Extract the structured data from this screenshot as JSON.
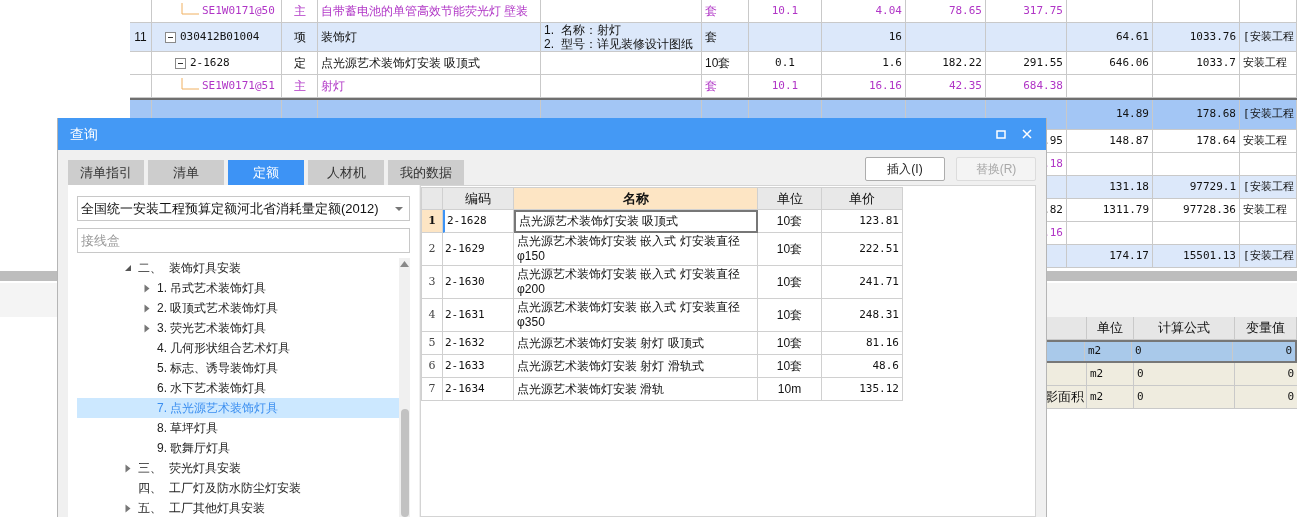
{
  "sheet": {
    "rows": [
      {
        "kind": "main",
        "selected": false,
        "column_2": "SE1W0171@50",
        "column_3": "主",
        "column_4": "自带蓄电池的单管高效节能荧光灯 壁装",
        "column_6": "套",
        "column_7": "10.1",
        "column_8": "4.04",
        "column_9": "78.65",
        "column_10": "317.75"
      },
      {
        "kind": "item",
        "selected": false,
        "expanded": true,
        "column_1": "11",
        "column_2": "030412B01004",
        "column_3": "项",
        "column_4": "装饰灯",
        "column_5": [
          "1.  名称：射灯",
          "2.  型号：详见装修设计图纸"
        ],
        "column_6": "套",
        "column_8": "16",
        "column_11": "64.61",
        "column_12": "1033.76",
        "column_13": "[安装工程",
        "children": [
          {
            "kind": "quota",
            "selected": false,
            "expanded": true,
            "column_2": "2-1628",
            "column_3": "定",
            "column_4": "点光源艺术装饰灯安装 吸顶式",
            "column_6": "10套",
            "column_7": "0.1",
            "column_8": "1.6",
            "column_9": "182.22",
            "column_10": "291.55",
            "column_11": "646.06",
            "column_12": "1033.7",
            "column_13": "安装工程",
            "children": [
              {
                "kind": "main",
                "selected": false,
                "column_2": "SE1W0171@51",
                "column_3": "主",
                "column_4": "射灯",
                "column_6": "套",
                "column_7": "10.1",
                "column_8": "16.16",
                "column_9": "42.35",
                "column_10": "684.38"
              }
            ]
          }
        ]
      },
      {
        "kind": "item",
        "selected": true,
        "column_11": "14.89",
        "column_12": "178.68",
        "column_13": "[安装工程",
        "children": [
          {
            "kind": "quota",
            "selected": false,
            "column_10": ".95",
            "column_11": "148.87",
            "column_12": "178.64",
            "column_13": "安装工程",
            "children": [
              {
                "kind": "main",
                "selected": false,
                "column_10": ".18"
              }
            ]
          }
        ]
      },
      {
        "kind": "item",
        "selected": false,
        "column_11": "131.18",
        "column_12": "97729.1",
        "column_13": "[安装工程",
        "children": [
          {
            "kind": "quota",
            "selected": false,
            "column_10": ".82",
            "column_11": "1311.79",
            "column_12": "97728.36",
            "column_13": "安装工程",
            "children": [
              {
                "kind": "main",
                "selected": false,
                "column_10": ".16"
              }
            ]
          }
        ]
      },
      {
        "kind": "item",
        "selected": false,
        "column_11": "174.17",
        "column_12": "15501.13",
        "column_13": "[安装工程"
      }
    ]
  },
  "formula_table": {
    "columns": [
      "单位",
      "计算公式",
      "变量值"
    ],
    "rows": [
      {
        "selected": true,
        "unit": "m2",
        "formula": "0",
        "value": "0"
      },
      {
        "selected": false,
        "unit": "m2",
        "formula": "0",
        "value": "0"
      },
      {
        "selected": false,
        "column_1": "影面积",
        "unit": "m2",
        "formula": "0",
        "value": "0"
      }
    ]
  },
  "dialog": {
    "title": "查询",
    "tabs": [
      {
        "label": "清单指引",
        "selected": false
      },
      {
        "label": "清单",
        "selected": false
      },
      {
        "label": "定额",
        "selected": true
      },
      {
        "label": "人材机",
        "selected": false
      },
      {
        "label": "我的数据",
        "selected": false
      }
    ],
    "buttons": [
      {
        "label": "插入(I)",
        "disabled": false
      },
      {
        "label": "替换(R)",
        "disabled": true
      }
    ],
    "library_select": {
      "value": "全国统一安装工程预算定额河北省消耗量定额(2012)"
    },
    "search": {
      "placeholder": "接线盒"
    },
    "tree": [
      {
        "label": "二、  装饰灯具安装",
        "kind": "folder",
        "expanded": true,
        "selected": false,
        "children": [
          {
            "label": "1. 吊式艺术装饰灯具",
            "kind": "folder",
            "expanded": false,
            "selected": false
          },
          {
            "label": "2. 吸顶式艺术装饰灯具",
            "kind": "folder",
            "expanded": false,
            "selected": false
          },
          {
            "label": "3. 荧光艺术装饰灯具",
            "kind": "folder",
            "expanded": false,
            "selected": false
          },
          {
            "label": "4. 几何形状组合艺术灯具",
            "kind": "leaf",
            "selected": false
          },
          {
            "label": "5. 标志、诱导装饰灯具",
            "kind": "leaf",
            "selected": false
          },
          {
            "label": "6. 水下艺术装饰灯具",
            "kind": "leaf",
            "selected": false
          },
          {
            "label": "7. 点光源艺术装饰灯具",
            "kind": "leaf",
            "selected": true
          },
          {
            "label": "8. 草坪灯具",
            "kind": "leaf",
            "selected": false
          },
          {
            "label": "9. 歌舞厅灯具",
            "kind": "leaf",
            "selected": false
          }
        ]
      },
      {
        "label": "三、  荧光灯具安装",
        "kind": "folder",
        "expanded": false,
        "selected": false
      },
      {
        "label": "四、  工厂灯及防水防尘灯安装",
        "kind": "leaf",
        "selected": false
      },
      {
        "label": "五、  工厂其他灯具安装",
        "kind": "folder",
        "expanded": false,
        "selected": false
      }
    ],
    "results": {
      "columns": [
        {
          "label": "编码",
          "selected": false
        },
        {
          "label": "名称",
          "selected": true
        },
        {
          "label": "单位",
          "selected": false
        },
        {
          "label": "单价",
          "selected": false
        }
      ],
      "rows": [
        {
          "no": "1",
          "code": "2-1628",
          "name": "点光源艺术装饰灯安装 吸顶式",
          "unit": "10套",
          "price": "123.81",
          "selected": true
        },
        {
          "no": "2",
          "code": "2-1629",
          "name": "点光源艺术装饰灯安装 嵌入式 灯安装直径φ150",
          "unit": "10套",
          "price": "222.51",
          "selected": false
        },
        {
          "no": "3",
          "code": "2-1630",
          "name": "点光源艺术装饰灯安装 嵌入式 灯安装直径φ200",
          "unit": "10套",
          "price": "241.71",
          "selected": false
        },
        {
          "no": "4",
          "code": "2-1631",
          "name": "点光源艺术装饰灯安装 嵌入式 灯安装直径φ350",
          "unit": "10套",
          "price": "248.31",
          "selected": false
        },
        {
          "no": "5",
          "code": "2-1632",
          "name": "点光源艺术装饰灯安装 射灯 吸顶式",
          "unit": "10套",
          "price": "81.16",
          "selected": false
        },
        {
          "no": "6",
          "code": "2-1633",
          "name": "点光源艺术装饰灯安装 射灯 滑轨式",
          "unit": "10套",
          "price": "48.6",
          "selected": false
        },
        {
          "no": "7",
          "code": "2-1634",
          "name": "点光源艺术装饰灯安装 滑轨",
          "unit": "10m",
          "price": "135.12",
          "selected": false
        }
      ]
    }
  }
}
